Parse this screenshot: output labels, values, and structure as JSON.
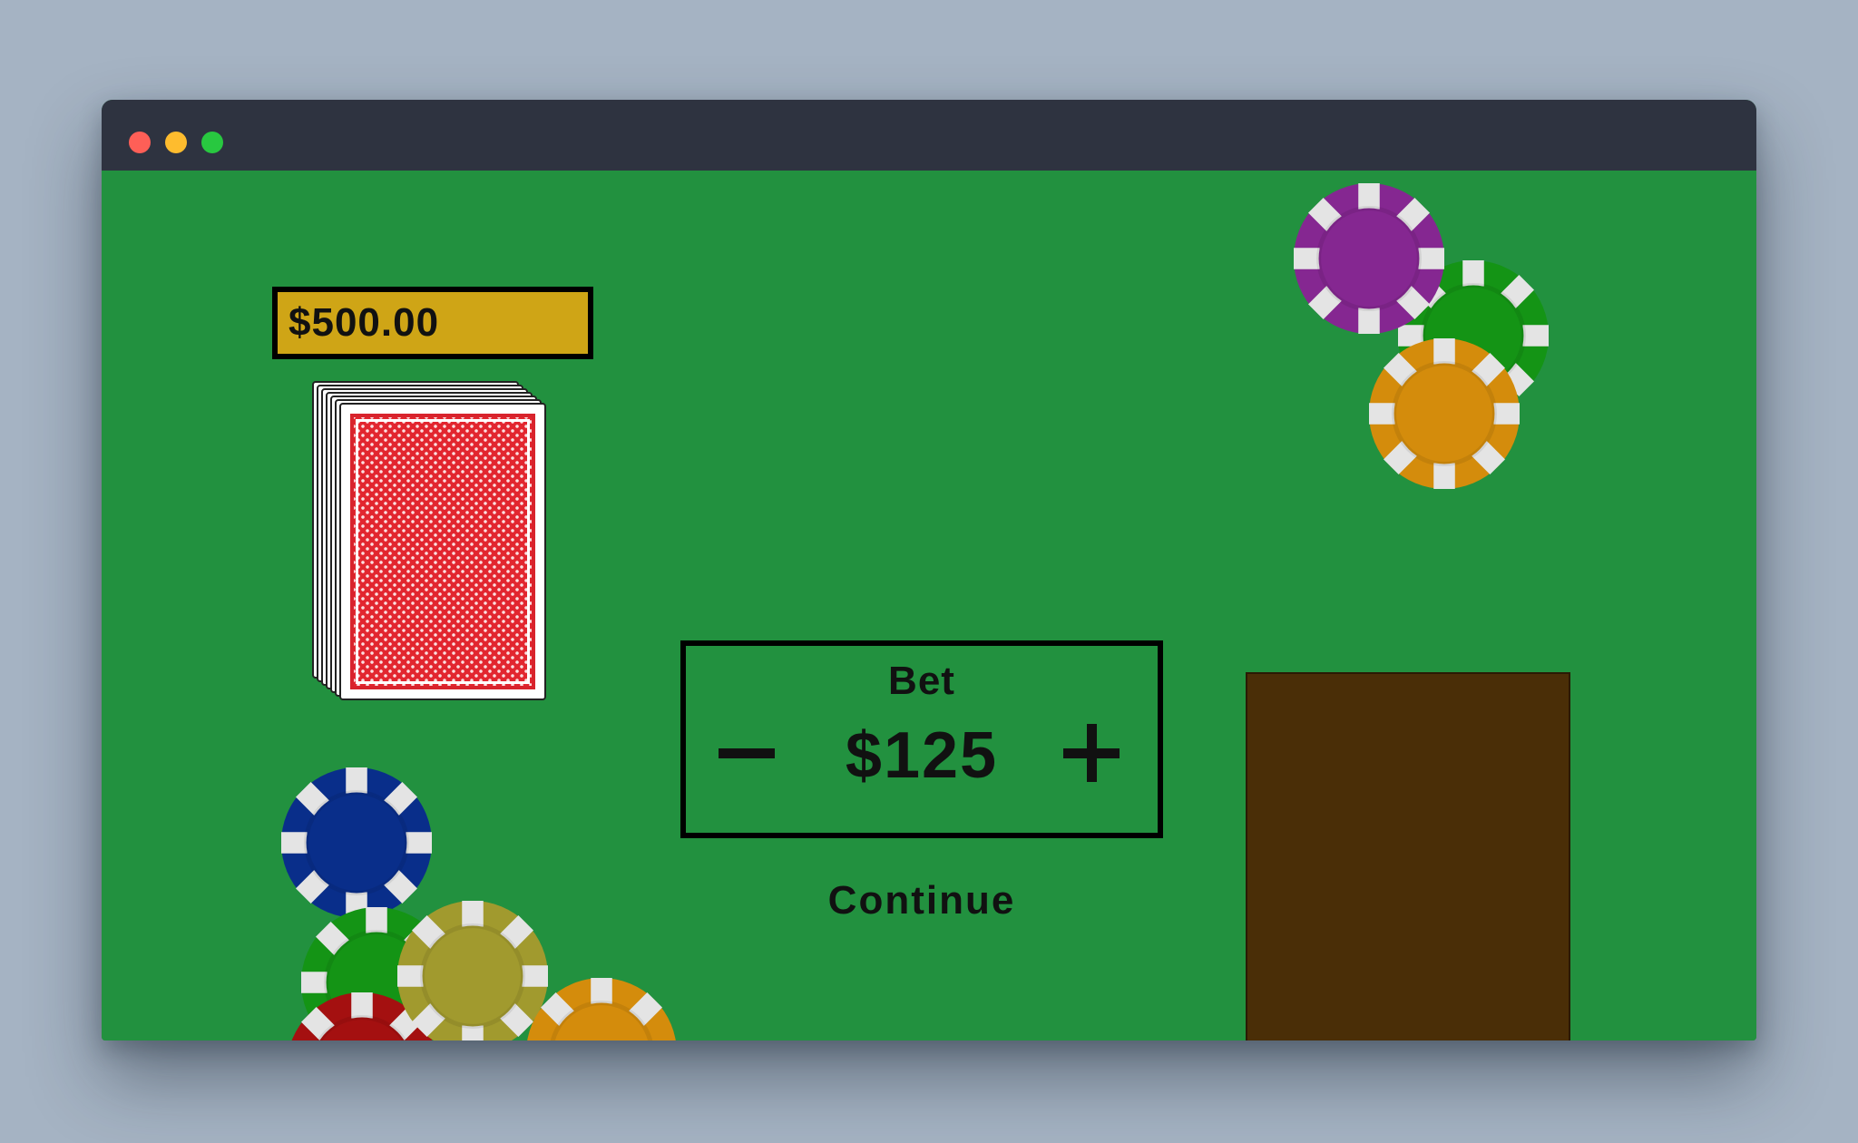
{
  "window": {
    "controls": [
      "close",
      "minimize",
      "maximize"
    ],
    "colors": {
      "close": "#fe5f57",
      "minimize": "#febc2e",
      "maximize": "#28c840",
      "titlebar": "#2e3340"
    }
  },
  "table": {
    "felt_color": "#22913f",
    "balance": "$500.00",
    "balance_color": "#cfa516",
    "deck": {
      "visible_cards": 7,
      "back_color": "#e2262f"
    },
    "bet": {
      "label": "Bet",
      "amount": "$125",
      "decrease_icon": "minus-icon",
      "increase_icon": "plus-icon"
    },
    "continue_label": "Continue",
    "discard_tray_color": "#4a2e07",
    "chips_top_right": [
      {
        "color": "#149415",
        "name": "green-chip"
      },
      {
        "color": "#852791",
        "name": "purple-chip"
      },
      {
        "color": "#d48c0c",
        "name": "orange-chip"
      }
    ],
    "chips_bottom_left": [
      {
        "color": "#092e8a",
        "name": "blue-chip"
      },
      {
        "color": "#149415",
        "name": "green-chip"
      },
      {
        "color": "#a41010",
        "name": "red-chip"
      },
      {
        "color": "#a19a2e",
        "name": "olive-chip"
      },
      {
        "color": "#d48c0c",
        "name": "orange-chip"
      }
    ]
  }
}
